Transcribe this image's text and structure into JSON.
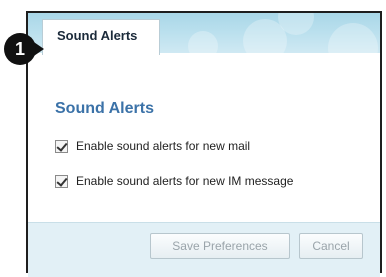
{
  "tabs": [
    {
      "label": "Sound Alerts",
      "active": true
    }
  ],
  "step_marker": "1",
  "section": {
    "title": "Sound Alerts"
  },
  "options": [
    {
      "label": "Enable sound alerts for new mail",
      "checked": true
    },
    {
      "label": "Enable sound alerts for new IM message",
      "checked": true
    }
  ],
  "actions": {
    "save_label": "Save Preferences",
    "cancel_label": "Cancel"
  },
  "colors": {
    "tabstrip": "#bfe2ef",
    "section_title": "#3b72a8",
    "footer": "#e2f0f6"
  }
}
